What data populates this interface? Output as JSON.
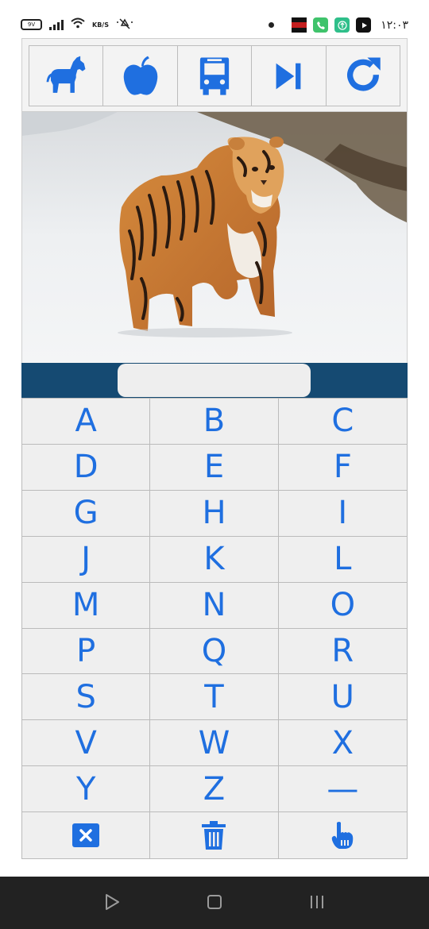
{
  "status_bar": {
    "battery_label": "9V",
    "speed_unit": "KB/S",
    "time": "١٢:٠٣",
    "icons": [
      "battery-icon",
      "signal-icon",
      "wifi-icon",
      "data-speed-icon",
      "mute-icon",
      "notification-dot-icon",
      "app-notification-icon",
      "phone-icon",
      "upload-icon",
      "youtube-icon"
    ]
  },
  "toolbar": {
    "buttons": [
      {
        "name": "animals",
        "icon": "horse-icon"
      },
      {
        "name": "fruits",
        "icon": "apple-icon"
      },
      {
        "name": "vehicles",
        "icon": "bus-icon"
      },
      {
        "name": "next",
        "icon": "skip-next-icon"
      },
      {
        "name": "reload",
        "icon": "redo-icon"
      }
    ]
  },
  "picture": {
    "subject": "tiger"
  },
  "answer": {
    "value": ""
  },
  "keyboard": {
    "letters": [
      "A",
      "B",
      "C",
      "D",
      "E",
      "F",
      "G",
      "H",
      "I",
      "J",
      "K",
      "L",
      "M",
      "N",
      "O",
      "P",
      "Q",
      "R",
      "S",
      "T",
      "U",
      "V",
      "W",
      "X",
      "Y",
      "Z",
      "—"
    ],
    "actions": [
      {
        "name": "delete",
        "icon": "close-box-icon"
      },
      {
        "name": "clear",
        "icon": "trash-icon"
      },
      {
        "name": "hint",
        "icon": "pointing-hand-icon"
      }
    ]
  },
  "colors": {
    "accent": "#1f6fe0",
    "answer_bar": "#154a72",
    "key_background": "#efefef",
    "nav_bar": "#222222"
  },
  "nav_bar": {
    "icons": [
      "back-triangle-icon",
      "home-square-icon",
      "recents-lines-icon"
    ]
  }
}
